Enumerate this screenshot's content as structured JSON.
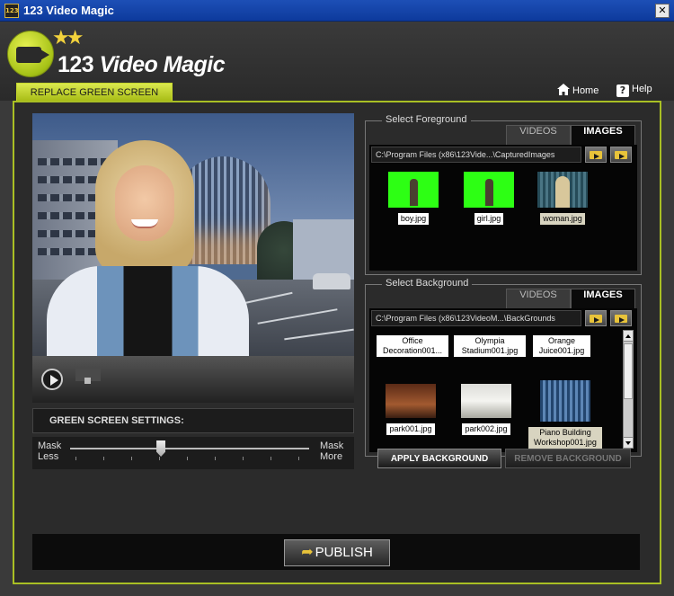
{
  "window": {
    "title": "123 Video Magic",
    "icon_text": "123",
    "close_label": "✕"
  },
  "header": {
    "logo_num": "123",
    "logo_name": " Video Magic",
    "page_tab": "REPLACE GREEN SCREEN",
    "home_label": "Home",
    "help_label": "Help",
    "help_glyph": "?"
  },
  "settings": {
    "title": "GREEN SCREEN SETTINGS:",
    "mask_less": "Mask Less",
    "mask_more": "Mask More",
    "mask_level_percent": 38
  },
  "foreground": {
    "legend": "Select Foreground",
    "tabs": [
      {
        "label": "VIDEOS",
        "active": false
      },
      {
        "label": "IMAGES",
        "active": true
      }
    ],
    "path": "C:\\Program Files (x86\\123Vide...\\CapturedImages",
    "items": [
      {
        "label": "boy.jpg"
      },
      {
        "label": "girl.jpg"
      },
      {
        "label": "woman.jpg",
        "selected": true
      }
    ]
  },
  "background": {
    "legend": "Select Background",
    "tabs": [
      {
        "label": "VIDEOS",
        "active": false
      },
      {
        "label": "IMAGES",
        "active": true
      }
    ],
    "path": "C:\\Program Files (x86\\123VideoM...\\BackGrounds",
    "items": [
      {
        "label": "Office Decoration001..."
      },
      {
        "label": "Olympia Stadium001.jpg"
      },
      {
        "label": "Orange Juice001.jpg"
      },
      {
        "label": "park001.jpg"
      },
      {
        "label": "park002.jpg"
      },
      {
        "label": "Piano Building Workshop001.jpg",
        "selected": true
      }
    ],
    "apply_label": "APPLY BACKGROUND",
    "remove_label": "REMOVE BACKGROUND"
  },
  "publish": {
    "label": "PUBLISH"
  }
}
